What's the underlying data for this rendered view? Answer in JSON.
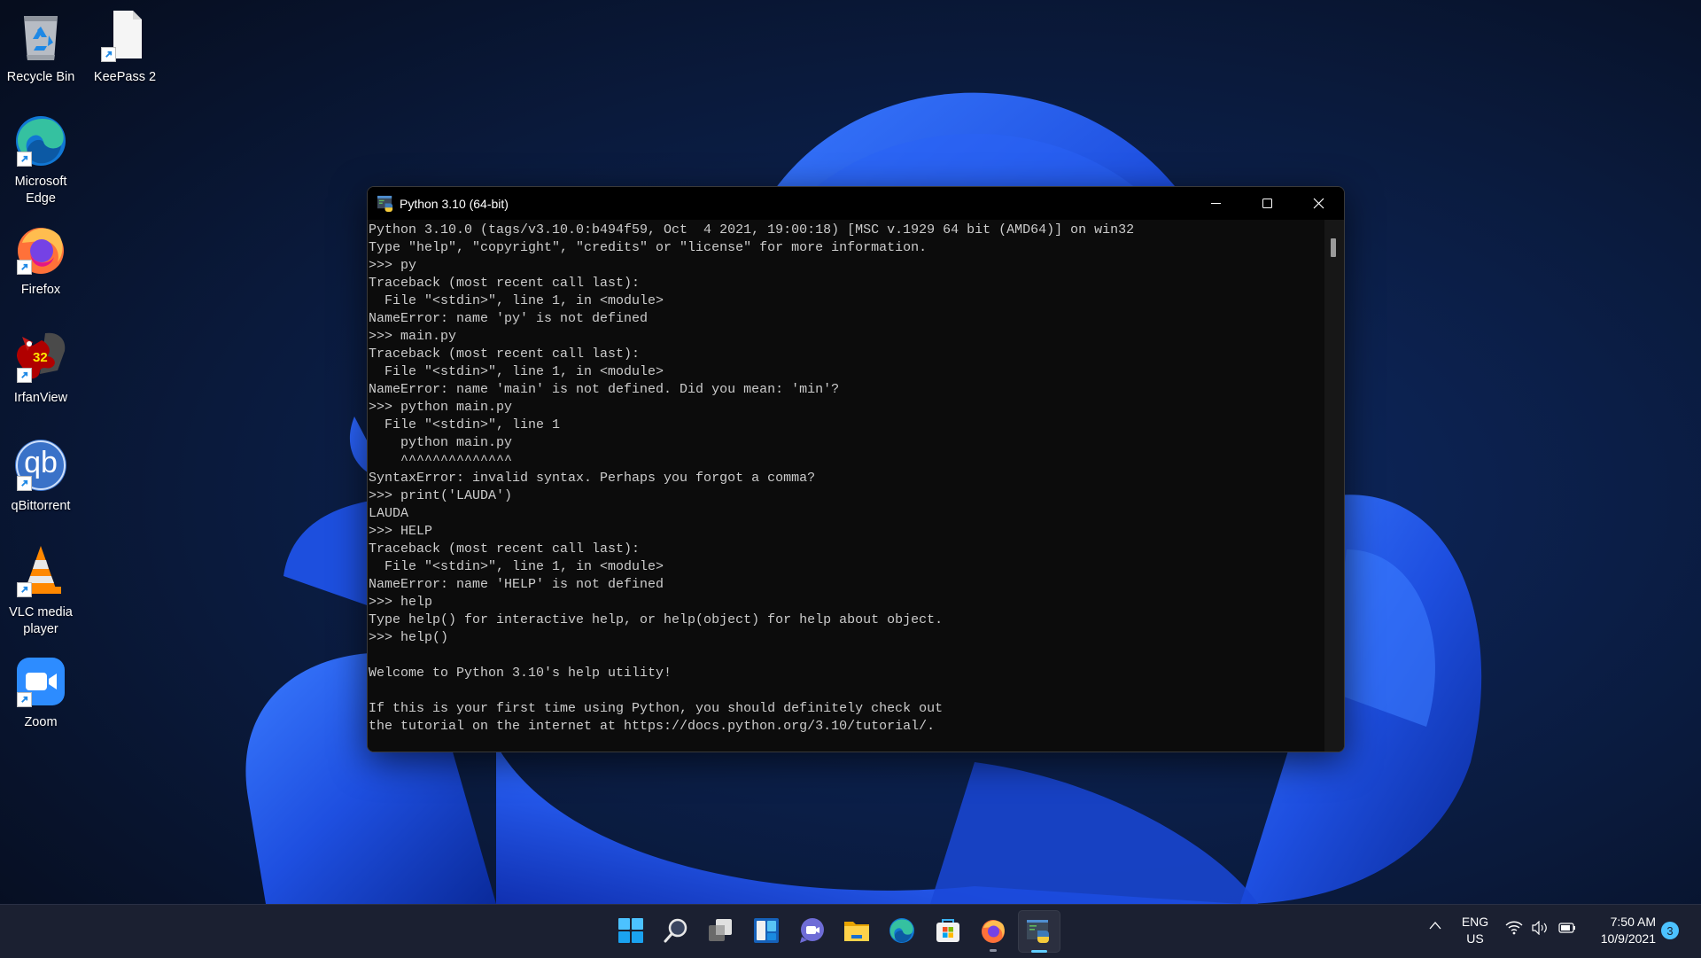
{
  "desktop": {
    "icons": [
      {
        "label": "Recycle Bin",
        "icon": "recycle-bin-icon",
        "shortcut": false
      },
      {
        "label": "KeePass 2",
        "icon": "file-icon",
        "shortcut": true
      },
      {
        "label": "Microsoft Edge",
        "icon": "edge-icon",
        "shortcut": true
      },
      {
        "label": "Firefox",
        "icon": "firefox-icon",
        "shortcut": true
      },
      {
        "label": "IrfanView",
        "icon": "irfanview-icon",
        "shortcut": true,
        "badge": "32"
      },
      {
        "label": "qBittorrent",
        "icon": "qbittorrent-icon",
        "shortcut": true,
        "glyph": "qb"
      },
      {
        "label": "VLC media player",
        "icon": "vlc-icon",
        "shortcut": true
      },
      {
        "label": "Zoom",
        "icon": "zoom-icon",
        "shortcut": true
      }
    ]
  },
  "console": {
    "title": "Python 3.10 (64-bit)",
    "lines": [
      "Python 3.10.0 (tags/v3.10.0:b494f59, Oct  4 2021, 19:00:18) [MSC v.1929 64 bit (AMD64)] on win32",
      "Type \"help\", \"copyright\", \"credits\" or \"license\" for more information.",
      ">>> py",
      "Traceback (most recent call last):",
      "  File \"<stdin>\", line 1, in <module>",
      "NameError: name 'py' is not defined",
      ">>> main.py",
      "Traceback (most recent call last):",
      "  File \"<stdin>\", line 1, in <module>",
      "NameError: name 'main' is not defined. Did you mean: 'min'?",
      ">>> python main.py",
      "  File \"<stdin>\", line 1",
      "    python main.py",
      "    ^^^^^^^^^^^^^^",
      "SyntaxError: invalid syntax. Perhaps you forgot a comma?",
      ">>> print('LAUDA')",
      "LAUDA",
      ">>> HELP",
      "Traceback (most recent call last):",
      "  File \"<stdin>\", line 1, in <module>",
      "NameError: name 'HELP' is not defined",
      ">>> help",
      "Type help() for interactive help, or help(object) for help about object.",
      ">>> help()",
      "",
      "Welcome to Python 3.10's help utility!",
      "",
      "If this is your first time using Python, you should definitely check out",
      "the tutorial on the internet at https://docs.python.org/3.10/tutorial/."
    ],
    "buttons": {
      "minimize": "minimize-icon",
      "maximize": "maximize-icon",
      "close": "close-icon"
    }
  },
  "taskbar": {
    "apps": [
      {
        "name": "Start",
        "icon": "windows-start-icon"
      },
      {
        "name": "Search",
        "icon": "search-icon"
      },
      {
        "name": "Task View",
        "icon": "task-view-icon"
      },
      {
        "name": "Widgets",
        "icon": "widgets-icon"
      },
      {
        "name": "Chat",
        "icon": "chat-icon"
      },
      {
        "name": "File Explorer",
        "icon": "folder-icon"
      },
      {
        "name": "Microsoft Edge",
        "icon": "edge-icon"
      },
      {
        "name": "Microsoft Store",
        "icon": "store-icon"
      },
      {
        "name": "Firefox",
        "icon": "firefox-icon",
        "running": true
      },
      {
        "name": "Python 3.10",
        "icon": "python-icon",
        "running": true,
        "active": true
      }
    ],
    "tray": {
      "language_line1": "ENG",
      "language_line2": "US",
      "time": "7:50 AM",
      "date": "10/9/2021",
      "notification_count": "3"
    }
  },
  "colors": {
    "console_bg": "#0c0c0c",
    "console_text": "#cccccc",
    "taskbar_bg": "#1b2031",
    "accent": "#60cdff"
  }
}
